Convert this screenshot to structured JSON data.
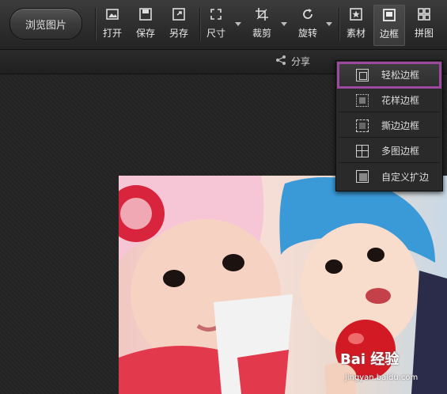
{
  "toolbar": {
    "browse_label": "浏览图片",
    "tools": [
      {
        "id": "open",
        "label": "打开",
        "icon": "open-image-icon"
      },
      {
        "id": "save",
        "label": "保存",
        "icon": "save-icon"
      },
      {
        "id": "save_as",
        "label": "另存",
        "icon": "save-as-icon"
      },
      {
        "id": "size",
        "label": "尺寸",
        "icon": "resize-icon"
      },
      {
        "id": "crop",
        "label": "裁剪",
        "icon": "crop-icon"
      },
      {
        "id": "rotate",
        "label": "旋转",
        "icon": "rotate-icon"
      },
      {
        "id": "material",
        "label": "素材",
        "icon": "star-icon"
      },
      {
        "id": "border",
        "label": "边框",
        "icon": "border-icon",
        "active": true
      },
      {
        "id": "collage",
        "label": "拼图",
        "icon": "grid-icon"
      }
    ]
  },
  "subbar": {
    "share_label": "分享"
  },
  "border_menu": {
    "items": [
      {
        "label": "轻松边框",
        "icon": "simple-border-icon",
        "selected": true
      },
      {
        "label": "花样边框",
        "icon": "fancy-border-icon"
      },
      {
        "label": "撕边边框",
        "icon": "torn-edge-border-icon"
      },
      {
        "label": "多图边框",
        "icon": "multi-image-border-icon"
      },
      {
        "label": "自定义扩边",
        "icon": "custom-expand-icon"
      }
    ]
  },
  "watermark": {
    "brand": "Bai 经验",
    "url": "jingyan.baidu.com"
  },
  "colors": {
    "accent_selected": "#9b4aa0",
    "toolbar_bg": "#2c2c2c"
  }
}
